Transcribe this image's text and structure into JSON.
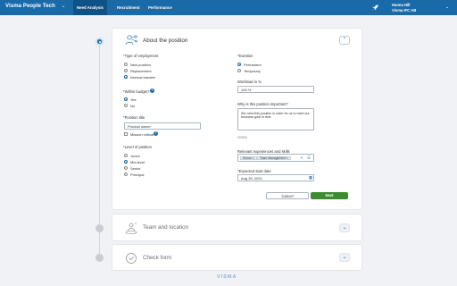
{
  "header": {
    "brand": "Visma People Tech",
    "tabs": [
      {
        "label": "Need Analysis",
        "active": true
      },
      {
        "label": "Recruitment",
        "active": false
      },
      {
        "label": "Performance",
        "active": false
      }
    ],
    "user": {
      "name": "Hanna Hill",
      "company": "Visma IFC AB"
    },
    "icons": [
      "chevron-down-icon",
      "rocket-icon"
    ]
  },
  "section_about": {
    "title": "About the position",
    "type_of_employment": {
      "label": "*Type of employment",
      "options": [
        "New position",
        "Replacement",
        "Internal transfer"
      ],
      "selected": "Internal transfer"
    },
    "budget": {
      "label": "*Within budget?",
      "options": [
        "Yes",
        "No"
      ],
      "selected": "Yes"
    },
    "position_title": {
      "label": "*Position title",
      "value": "Product owner",
      "checkbox_label": "Mission critical"
    },
    "level": {
      "label": "*Level of position",
      "options": [
        "Junior",
        "Mid-level",
        "Senior",
        "Principal"
      ],
      "selected": "Mid-level"
    },
    "duration": {
      "label": "*Duration",
      "options": [
        "Permanent",
        "Temporary"
      ],
      "selected": "Permanent"
    },
    "workload": {
      "label": "Workload in %",
      "value": "100 %"
    },
    "why": {
      "label": "Why is this position important?",
      "value": "We need this position in order for us to meet our business goal in time",
      "counter": "20/500"
    },
    "skills": {
      "label": "Relevant experiences and skills",
      "tags": [
        "Scrum",
        "Team Management"
      ]
    },
    "start_date": {
      "label": "*Expected start date",
      "value": "Aug 30, 2021"
    },
    "buttons": {
      "cancel": "Cancel",
      "next": "Next"
    }
  },
  "section_team": {
    "title": "Team and location"
  },
  "section_check": {
    "title": "Check form"
  },
  "footer": {
    "logo": "VISMA"
  },
  "colors": {
    "primary": "#1b6aa8",
    "success": "#3c8d2f",
    "background": "#f0f2f5"
  }
}
